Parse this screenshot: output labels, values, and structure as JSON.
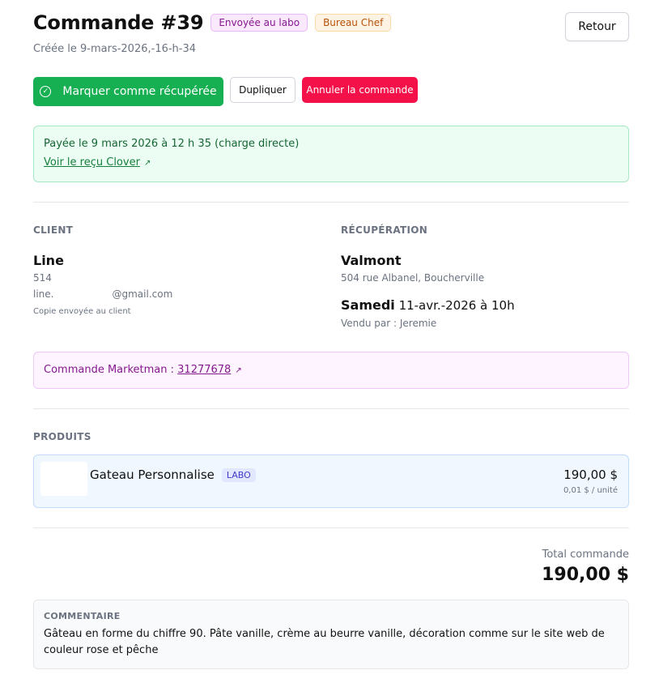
{
  "header": {
    "title": "Commande #39",
    "status_badge": "Envoyée au labo",
    "location_badge": "Bureau Chef",
    "created": "Créée le 9-mars-2026,-16-h-34",
    "back_label": "Retour"
  },
  "actions": {
    "mark_picked_up": "Marquer comme récupérée",
    "duplicate": "Dupliquer",
    "cancel": "Annuler la commande"
  },
  "payment": {
    "text": "Payée le 9 mars 2026 à 12 h 35 (charge directe)",
    "receipt_link": "Voir le reçu Clover"
  },
  "client": {
    "label": "CLIENT",
    "name": "Line",
    "phone": "514",
    "email_prefix": "line.",
    "email_suffix": "@gmail.com",
    "copy_note": "Copie envoyée au client"
  },
  "pickup": {
    "label": "RÉCUPÉRATION",
    "store": "Valmont",
    "address": "504 rue Albanel, Boucherville",
    "day": "Samedi",
    "datetime": "11-avr.-2026 à 10h",
    "sold_by": "Vendu par : Jeremie"
  },
  "marketman": {
    "label": "Commande Marketman :",
    "number": "31277678"
  },
  "products": {
    "label": "PRODUITS",
    "items": [
      {
        "name": "Gateau Personnalise",
        "badge": "LABO",
        "price": "190,00 $",
        "unit_price": "0,01 $ / unité"
      }
    ]
  },
  "total": {
    "label": "Total commande",
    "value": "190,00 $"
  },
  "comment": {
    "label": "COMMENTAIRE",
    "text": "Gâteau en forme du chiffre 90. Pâte vanille, crème au beurre vanille, décoration comme sur le site web de couleur rose et pêche"
  }
}
